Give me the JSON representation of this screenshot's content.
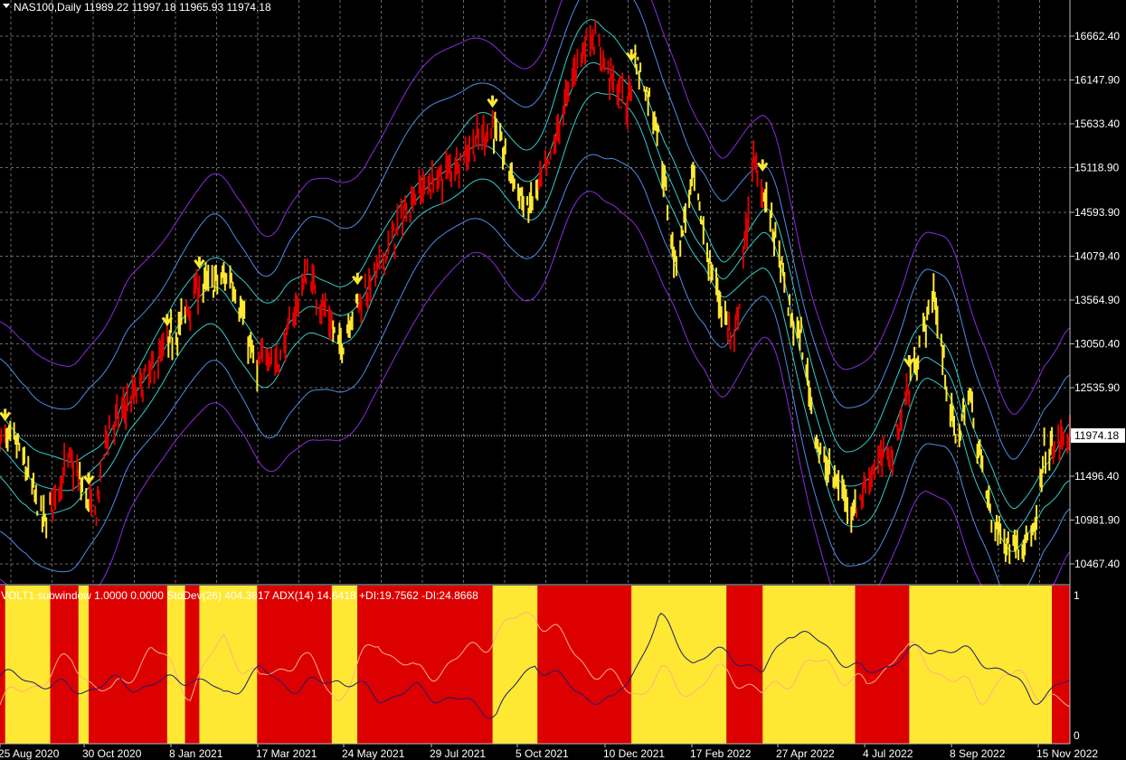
{
  "header": {
    "symbol": "NAS100,Daily",
    "ohlc": "11989.22 11997.18 11965.93 11974.18"
  },
  "subwindow_header": {
    "text": "VOLT1 subwindow 1.0000 0.0000  StdDev(26) 404.3817  ADX(14) 14.6418 +DI:19.7562 -DI:24.8668"
  },
  "colors": {
    "background": "#000000",
    "grid": "#6a6a6a",
    "bull": "#dd0000",
    "bear": "#ffe833",
    "outer_band": "#8a2be2",
    "mid_band": "#4f8be8",
    "inner_band": "#33cccc",
    "adx_line": "#1a1a6e",
    "std_line": "#ffb080",
    "current_price": "#ffffff"
  },
  "chart_data": [
    {
      "type": "line",
      "symbol": "NAS100",
      "timeframe": "Daily",
      "current_price": 11974.18,
      "y_ticks": [
        16662.4,
        16147.9,
        15633.4,
        15118.9,
        14593.9,
        14079.4,
        13564.9,
        13050.4,
        12535.9,
        11974.18,
        11496.4,
        10981.9,
        10467.4
      ],
      "ylim": [
        10300,
        17300
      ],
      "x_tick_labels": [
        "25 Aug 2020",
        "30 Oct 2020",
        "8 Jan 2021",
        "17 Mar 2021",
        "24 May 2021",
        "29 Jul 2021",
        "5 Oct 2021",
        "10 Dec 2021",
        "17 Feb 2022",
        "27 Apr 2022",
        "4 Jul 2022",
        "8 Sep 2022",
        "15 Nov 2022"
      ],
      "price_path": {
        "x": [
          "2020-08-20",
          "2020-09-03",
          "2020-09-23",
          "2020-10-13",
          "2020-11-02",
          "2020-11-11",
          "2020-12-10",
          "2021-01-08",
          "2021-01-20",
          "2021-02-16",
          "2021-03-08",
          "2021-03-15",
          "2021-03-24",
          "2021-04-16",
          "2021-05-12",
          "2021-05-20",
          "2021-06-10",
          "2021-07-07",
          "2021-07-28",
          "2021-09-07",
          "2021-10-04",
          "2021-10-20",
          "2021-11-10",
          "2021-11-22",
          "2021-12-20",
          "2021-12-27",
          "2022-01-12",
          "2022-01-27",
          "2022-02-10",
          "2022-02-24",
          "2022-03-14",
          "2022-03-29",
          "2022-04-12",
          "2022-04-27",
          "2022-05-05",
          "2022-05-20",
          "2022-06-16",
          "2022-06-30",
          "2022-07-15",
          "2022-08-16",
          "2022-09-02",
          "2022-09-13",
          "2022-09-30",
          "2022-10-13",
          "2022-11-03",
          "2022-11-10",
          "2022-11-30"
        ],
        "close": [
          11950,
          11850,
          10950,
          11700,
          11000,
          12000,
          12600,
          13300,
          13700,
          13850,
          12700,
          13000,
          12800,
          13900,
          13000,
          13400,
          13900,
          14800,
          15000,
          15600,
          14600,
          15100,
          16300,
          16700,
          15800,
          16400,
          15700,
          14000,
          15000,
          13900,
          13000,
          15200,
          14500,
          13350,
          13100,
          11700,
          11100,
          11600,
          11800,
          13650,
          11900,
          12450,
          11000,
          10700,
          10800,
          11750,
          11974.18
        ]
      },
      "color_zones": [
        {
          "from": "2020-08-20",
          "to": "2020-08-24",
          "trend": "bull"
        },
        {
          "from": "2020-08-24",
          "to": "2020-09-28",
          "trend": "bear"
        },
        {
          "from": "2020-09-28",
          "to": "2020-10-20",
          "trend": "bull"
        },
        {
          "from": "2020-10-20",
          "to": "2020-10-28",
          "trend": "bear"
        },
        {
          "from": "2020-10-28",
          "to": "2020-12-28",
          "trend": "bull"
        },
        {
          "from": "2020-12-28",
          "to": "2021-01-11",
          "trend": "bear"
        },
        {
          "from": "2021-01-11",
          "to": "2021-01-22",
          "trend": "bull"
        },
        {
          "from": "2021-01-22",
          "to": "2021-03-08",
          "trend": "bear"
        },
        {
          "from": "2021-03-08",
          "to": "2021-05-05",
          "trend": "bull"
        },
        {
          "from": "2021-05-05",
          "to": "2021-05-25",
          "trend": "bear"
        },
        {
          "from": "2021-05-25",
          "to": "2021-09-07",
          "trend": "bull"
        },
        {
          "from": "2021-09-07",
          "to": "2021-10-12",
          "trend": "bear"
        },
        {
          "from": "2021-10-12",
          "to": "2021-12-24",
          "trend": "bull"
        },
        {
          "from": "2021-12-24",
          "to": "2022-03-08",
          "trend": "bear"
        },
        {
          "from": "2022-03-08",
          "to": "2022-04-05",
          "trend": "bull"
        },
        {
          "from": "2022-04-05",
          "to": "2022-06-16",
          "trend": "bear"
        },
        {
          "from": "2022-06-16",
          "to": "2022-07-28",
          "trend": "bull"
        },
        {
          "from": "2022-07-28",
          "to": "2022-11-16",
          "trend": "bear"
        },
        {
          "from": "2022-11-16",
          "to": "2022-11-30",
          "trend": "bull"
        }
      ],
      "signal_arrows": [
        "2020-08-24",
        "2020-10-28",
        "2020-12-28",
        "2021-01-22",
        "2021-05-25",
        "2021-09-07",
        "2021-12-24",
        "2022-04-05",
        "2022-07-28"
      ],
      "bands": {
        "inner_offset": 350,
        "mid_offset": 900,
        "outer_offset": 1400
      }
    },
    {
      "type": "area",
      "ylim": [
        0,
        1
      ],
      "y_ticks": [
        1,
        0
      ],
      "zones_follow_main_trend": true,
      "adx_line": {
        "x": [
          "2020-08-20",
          "2020-09-15",
          "2020-10-15",
          "2020-11-15",
          "2020-12-15",
          "2021-01-15",
          "2021-02-10",
          "2021-03-10",
          "2021-04-10",
          "2021-05-10",
          "2021-06-10",
          "2021-07-10",
          "2021-08-10",
          "2021-09-10",
          "2021-10-10",
          "2021-11-10",
          "2021-12-10",
          "2022-01-01",
          "2022-01-15",
          "2022-02-10",
          "2022-03-10",
          "2022-04-05",
          "2022-04-25",
          "2022-05-25",
          "2022-06-25",
          "2022-07-20",
          "2022-08-20",
          "2022-09-20",
          "2022-10-10",
          "2022-11-01",
          "2022-11-30"
        ],
        "values": [
          0.45,
          0.42,
          0.35,
          0.4,
          0.38,
          0.45,
          0.32,
          0.48,
          0.36,
          0.44,
          0.3,
          0.35,
          0.28,
          0.2,
          0.55,
          0.35,
          0.25,
          0.6,
          0.85,
          0.55,
          0.62,
          0.45,
          0.78,
          0.65,
          0.45,
          0.58,
          0.65,
          0.58,
          0.48,
          0.3,
          0.4
        ]
      },
      "std_line": {
        "x": [
          "2020-08-20",
          "2020-09-15",
          "2020-10-15",
          "2020-11-15",
          "2020-12-15",
          "2021-01-15",
          "2021-02-10",
          "2021-03-10",
          "2021-04-10",
          "2021-05-10",
          "2021-06-10",
          "2021-07-10",
          "2021-08-10",
          "2021-09-10",
          "2021-10-10",
          "2021-11-10",
          "2021-12-10",
          "2022-01-01",
          "2022-01-15",
          "2022-02-10",
          "2022-03-10",
          "2022-04-05",
          "2022-04-25",
          "2022-05-25",
          "2022-06-25",
          "2022-07-20",
          "2022-08-20",
          "2022-09-20",
          "2022-10-10",
          "2022-11-01",
          "2022-11-30"
        ],
        "values": [
          0.25,
          0.4,
          0.55,
          0.3,
          0.65,
          0.35,
          0.7,
          0.4,
          0.6,
          0.3,
          0.7,
          0.45,
          0.55,
          0.75,
          0.9,
          0.6,
          0.4,
          0.35,
          0.45,
          0.35,
          0.5,
          0.3,
          0.45,
          0.55,
          0.35,
          0.65,
          0.5,
          0.3,
          0.45,
          0.4,
          0.2
        ]
      }
    }
  ]
}
